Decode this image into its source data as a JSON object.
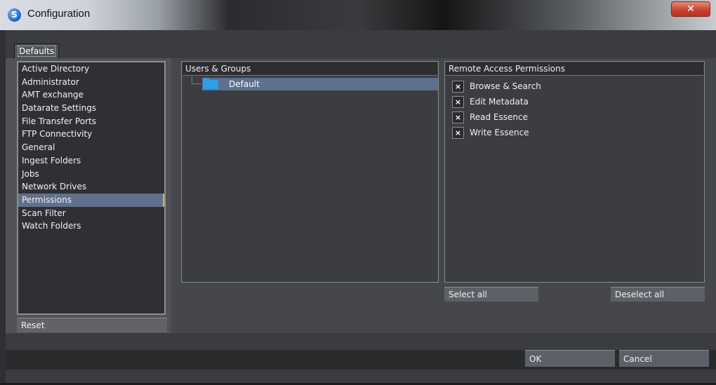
{
  "window": {
    "title": "Configuration",
    "close_symbol": "✕"
  },
  "tabs": [
    {
      "label": "Defaults"
    }
  ],
  "categories": [
    "Active Directory",
    "Administrator",
    "AMT exchange",
    "Datarate Settings",
    "File Transfer Ports",
    "FTP Connectivity",
    "General",
    "Ingest Folders",
    "Jobs",
    "Network Drives",
    "Permissions",
    "Scan Filter",
    "Watch Folders"
  ],
  "selected_category": "Permissions",
  "reset_label": "Reset",
  "users_panel": {
    "header": "Users & Groups",
    "items": [
      {
        "label": "Default",
        "icon": "folder-icon"
      }
    ]
  },
  "permissions_panel": {
    "header": "Remote Access Permissions",
    "check_mark": "×",
    "items": [
      {
        "label": "Browse & Search",
        "checked": true
      },
      {
        "label": "Edit Metadata",
        "checked": true
      },
      {
        "label": "Read Essence",
        "checked": true
      },
      {
        "label": "Write Essence",
        "checked": true
      }
    ]
  },
  "buttons": {
    "select_all": "Select all",
    "deselect_all": "Deselect all",
    "ok": "OK",
    "cancel": "Cancel"
  },
  "colors": {
    "selection": "#61718c",
    "accent": "#d9b23a",
    "folder": "#2aa0e8",
    "close": "#c94430"
  }
}
